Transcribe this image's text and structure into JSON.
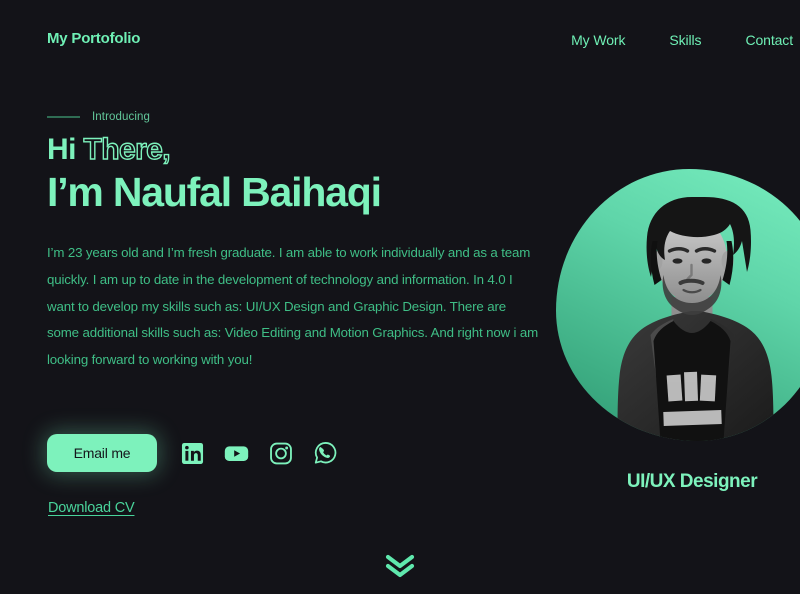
{
  "nav": {
    "logo": "My Portofolio",
    "links": [
      {
        "label": "My Work"
      },
      {
        "label": "Skills"
      },
      {
        "label": "Contact"
      }
    ]
  },
  "hero": {
    "eyebrow": "Introducing",
    "greeting_solid": "Hi ",
    "greeting_outline": "There,",
    "name_line": "I’m Naufal Baihaqi",
    "bio": "I’m 23 years old and I’m fresh graduate. I am able to work individually and as a team quickly. I am up to date in the development of technology and information. In 4.0 I want to develop my skills such as: UI/UX Design and Graphic Design. There are some additional skills such as: Video Editing and Motion Graphics. And right now i am looking forward to working with you!",
    "email_button": "Email me",
    "download_cv": "Download CV",
    "role_label": "UI/UX Designer",
    "socials": [
      {
        "name": "linkedin-icon"
      },
      {
        "name": "youtube-icon"
      },
      {
        "name": "instagram-icon"
      },
      {
        "name": "whatsapp-icon"
      }
    ]
  },
  "scroll": {
    "icon": "double-chevron-down-icon"
  },
  "colors": {
    "background": "#131318",
    "accent_mint": "#7DF2BC",
    "body_text": "#3FBE86",
    "eyebrow_dash": "#2F6C53",
    "button_text": "#14161B",
    "blob_gradient_from": "#79EFC0",
    "blob_gradient_to": "#2E9671"
  }
}
